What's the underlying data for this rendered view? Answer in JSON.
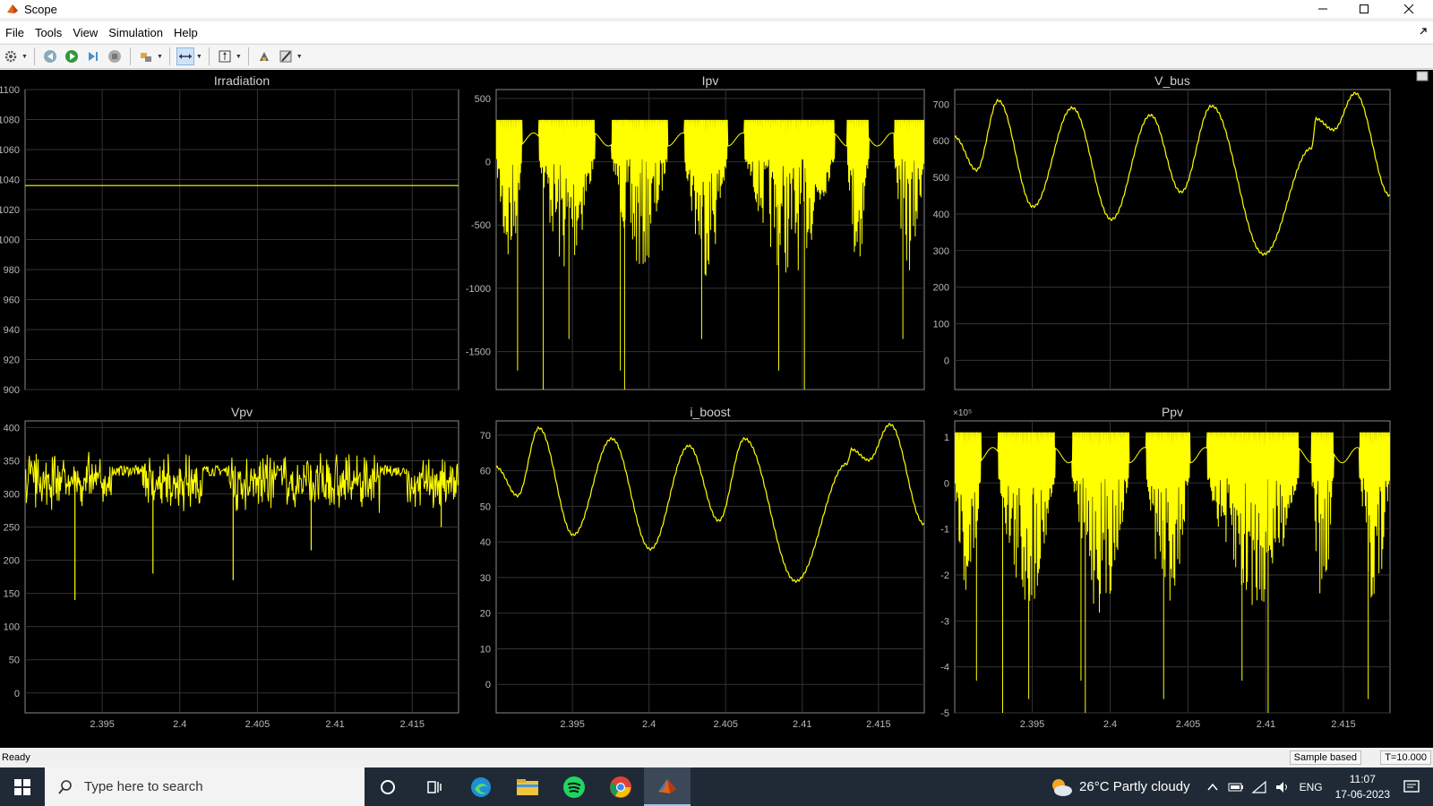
{
  "window": {
    "title": "Scope"
  },
  "menu": [
    "File",
    "Tools",
    "View",
    "Simulation",
    "Help"
  ],
  "toolbar_icons": [
    "gear-icon",
    "step-back-icon",
    "run-icon",
    "step-forward-icon",
    "stop-icon",
    "highlight-block-icon",
    "zoom-icon",
    "scale-axes-icon",
    "write-to-workspace-icon",
    "style-icon"
  ],
  "colors": {
    "signal": "#ffff00",
    "plot_bg": "#000000",
    "grid": "#333333",
    "axis_text": "#b8b8b8",
    "title_text": "#d0d0d0"
  },
  "plots": [
    {
      "title": "Irradiation",
      "exponent": "",
      "x_ticks": [],
      "y_ticks": [
        "1100",
        "1080",
        "1060",
        "1040",
        "1020",
        "1000",
        "980",
        "960",
        "940",
        "920",
        "900"
      ],
      "ylim": [
        900,
        1100
      ],
      "signal": "constant",
      "level": 1036
    },
    {
      "title": "Ipv",
      "exponent": "",
      "x_ticks": [],
      "y_ticks": [
        "500",
        "0",
        "-500",
        "-1000",
        "-1500"
      ],
      "ylim": [
        -1800,
        570
      ],
      "signal": "spiky",
      "upper": 330,
      "lower": -700,
      "spikes": [
        -1800,
        -1400,
        -1650
      ]
    },
    {
      "title": "V_bus",
      "exponent": "",
      "x_ticks": [],
      "y_ticks": [
        "700",
        "600",
        "500",
        "400",
        "300",
        "200",
        "100",
        "0"
      ],
      "ylim": [
        -80,
        740
      ],
      "signal": "wave",
      "peaks": [
        [
          0,
          610
        ],
        [
          0.05,
          520
        ],
        [
          0.1,
          710
        ],
        [
          0.18,
          420
        ],
        [
          0.27,
          690
        ],
        [
          0.36,
          385
        ],
        [
          0.45,
          670
        ],
        [
          0.52,
          460
        ],
        [
          0.59,
          695
        ],
        [
          0.71,
          290
        ],
        [
          0.82,
          580
        ],
        [
          0.83,
          660
        ],
        [
          0.87,
          630
        ],
        [
          0.92,
          730
        ],
        [
          1.0,
          450
        ]
      ]
    },
    {
      "title": "Vpv",
      "exponent": "",
      "x_ticks": [
        "2.395",
        "2.4",
        "2.405",
        "2.41",
        "2.415"
      ],
      "y_ticks": [
        "400",
        "350",
        "300",
        "250",
        "200",
        "150",
        "100",
        "50",
        "0"
      ],
      "ylim": [
        -30,
        410
      ],
      "signal": "noisy",
      "base": 335,
      "spikes": [
        [
          0.115,
          140
        ],
        [
          0.295,
          180
        ],
        [
          0.48,
          170
        ],
        [
          0.66,
          215
        ],
        [
          0.96,
          250
        ]
      ]
    },
    {
      "title": "i_boost",
      "exponent": "",
      "x_ticks": [
        "2.395",
        "2.4",
        "2.405",
        "2.41",
        "2.415"
      ],
      "y_ticks": [
        "70",
        "60",
        "50",
        "40",
        "30",
        "20",
        "10",
        "0"
      ],
      "ylim": [
        -8,
        74
      ],
      "signal": "wave",
      "peaks": [
        [
          0,
          61
        ],
        [
          0.05,
          53
        ],
        [
          0.1,
          72
        ],
        [
          0.18,
          42
        ],
        [
          0.27,
          69
        ],
        [
          0.36,
          38
        ],
        [
          0.45,
          67
        ],
        [
          0.52,
          46
        ],
        [
          0.58,
          69
        ],
        [
          0.7,
          29
        ],
        [
          0.82,
          62
        ],
        [
          0.83,
          66
        ],
        [
          0.87,
          63
        ],
        [
          0.92,
          73
        ],
        [
          1.0,
          45
        ]
      ]
    },
    {
      "title": "Ppv",
      "exponent": "×10⁵",
      "x_ticks": [
        "2.395",
        "2.4",
        "2.405",
        "2.41",
        "2.415"
      ],
      "y_ticks": [
        "1",
        "0",
        "-1",
        "-2",
        "-3",
        "-4",
        "-5"
      ],
      "ylim": [
        -5,
        1.35
      ],
      "signal": "spiky",
      "upper": 1.1,
      "lower": -2.2,
      "spikes": [
        -5,
        -4.7,
        -4.3
      ]
    }
  ],
  "status": {
    "text": "Ready",
    "mode": "Sample based",
    "time": "T=10.000"
  },
  "taskbar": {
    "search_placeholder": "Type here to search",
    "weather": "26°C  Partly cloudy",
    "lang": "ENG",
    "time": "11:07",
    "date": "17-06-2023"
  }
}
